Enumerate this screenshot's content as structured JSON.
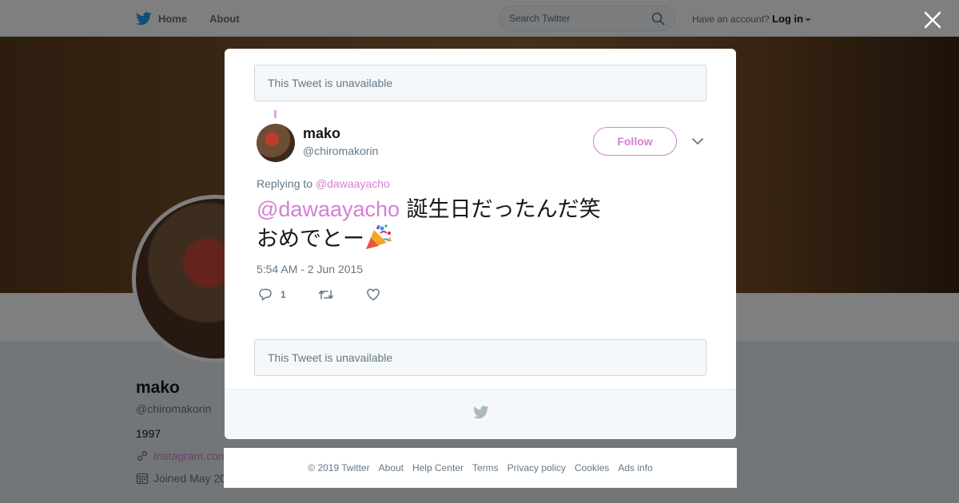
{
  "nav": {
    "home": "Home",
    "about": "About",
    "search_placeholder": "Search Twitter",
    "have_account": "Have an account?",
    "login": "Log in"
  },
  "profile": {
    "name": "mako",
    "handle": "@chiromakorin",
    "bio": "1997",
    "website": "Instagram.com",
    "joined": "Joined May 20"
  },
  "modal": {
    "unavailable_top": "This Tweet is unavailable",
    "unavailable_bottom": "This Tweet is unavailable",
    "tweet": {
      "name": "mako",
      "handle": "@chiromakorin",
      "follow_label": "Follow",
      "replying_prefix": "Replying to",
      "replying_to": "@dawaayacho",
      "mention": "@dawaayacho",
      "text_line1": "誕生日だったんだ笑",
      "text_line2": "おめでとー",
      "emoji": "party-popper-icon",
      "timestamp": "5:54 AM - 2 Jun 2015",
      "reply_count": "1"
    }
  },
  "footer": {
    "links": [
      "© 2019 Twitter",
      "About",
      "Help Center",
      "Terms",
      "Privacy policy",
      "Cookies",
      "Ads info"
    ]
  },
  "colors": {
    "accent": "#d480d4",
    "twitter_blue": "#1da1f2",
    "overlay": "rgba(0,0,0,0.5)"
  }
}
